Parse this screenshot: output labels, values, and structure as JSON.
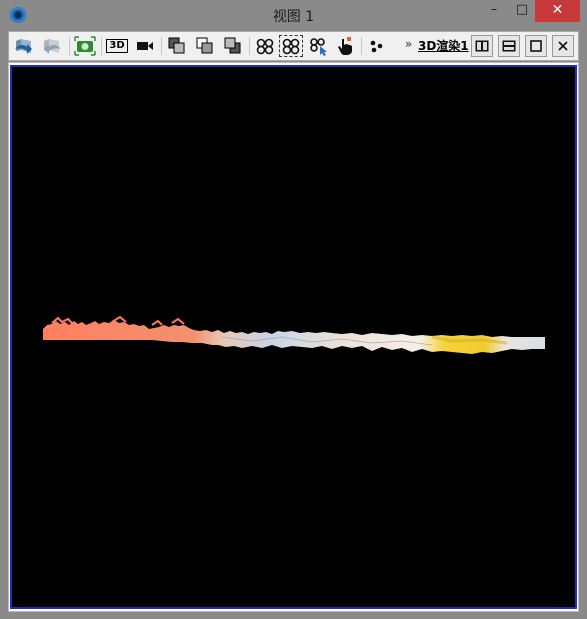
{
  "window": {
    "title": "视图 1",
    "minimize_label": "–",
    "maximize_label": "□",
    "close_label": "✕"
  },
  "toolbar": {
    "overflow_label": "»",
    "render_link": "3D渲染1",
    "threed_label": "3D"
  },
  "icons": [
    "back-icon",
    "forward-icon",
    "screenshot-icon",
    "3d-view-icon",
    "camera-video-icon",
    "layer-front-icon",
    "layer-middle-icon",
    "layer-back-icon",
    "hexagon-select-icon",
    "hexagon-dashed-select-icon",
    "hexagon-cursor-icon",
    "hand-pointer-icon",
    "dots-icon",
    "split-vertical-icon",
    "split-horizontal-icon",
    "maximize-view-icon",
    "close-view-icon"
  ]
}
